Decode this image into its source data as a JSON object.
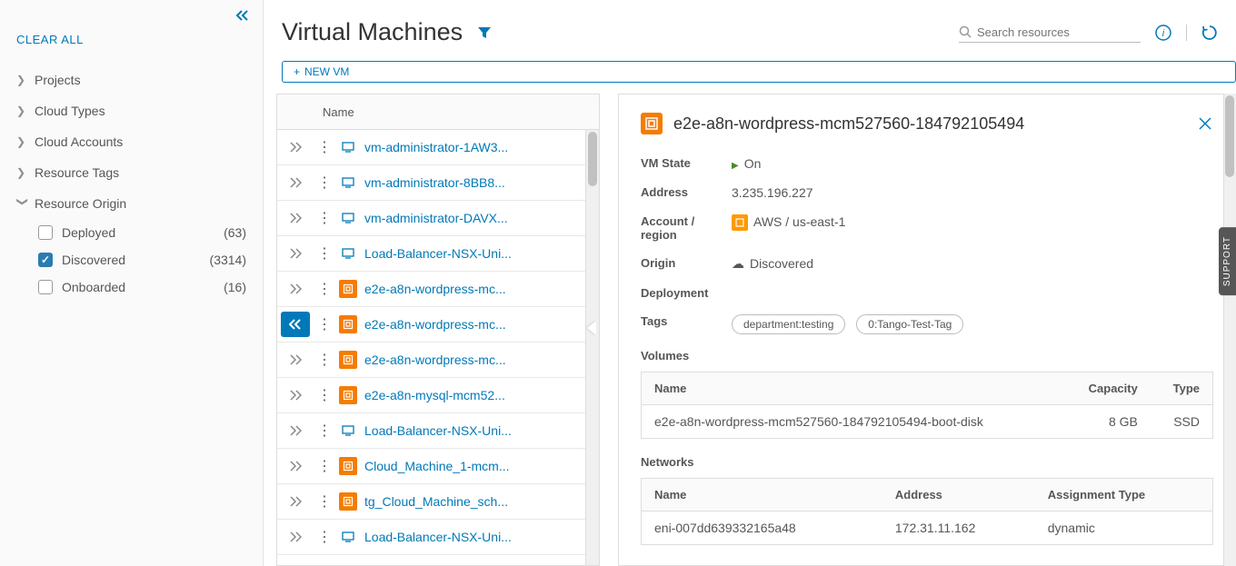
{
  "sidebar": {
    "clear_all": "CLEAR ALL",
    "filters": [
      {
        "label": "Projects",
        "expanded": false
      },
      {
        "label": "Cloud Types",
        "expanded": false
      },
      {
        "label": "Cloud Accounts",
        "expanded": false
      },
      {
        "label": "Resource Tags",
        "expanded": false
      },
      {
        "label": "Resource Origin",
        "expanded": true
      }
    ],
    "origin_options": [
      {
        "label": "Deployed",
        "count": "(63)",
        "checked": false
      },
      {
        "label": "Discovered",
        "count": "(3314)",
        "checked": true
      },
      {
        "label": "Onboarded",
        "count": "(16)",
        "checked": false
      }
    ]
  },
  "header": {
    "title": "Virtual Machines",
    "search_placeholder": "Search resources",
    "new_vm_label": "NEW VM"
  },
  "vm_list": {
    "name_header": "Name",
    "rows": [
      {
        "name": "vm-administrator-1AW3...",
        "icon": "blue",
        "selected": false
      },
      {
        "name": "vm-administrator-8BB8...",
        "icon": "blue",
        "selected": false
      },
      {
        "name": "vm-administrator-DAVX...",
        "icon": "blue",
        "selected": false
      },
      {
        "name": "Load-Balancer-NSX-Uni...",
        "icon": "blue",
        "selected": false
      },
      {
        "name": "e2e-a8n-wordpress-mc...",
        "icon": "orange",
        "selected": false
      },
      {
        "name": "e2e-a8n-wordpress-mc...",
        "icon": "orange",
        "selected": true
      },
      {
        "name": "e2e-a8n-wordpress-mc...",
        "icon": "orange",
        "selected": false
      },
      {
        "name": "e2e-a8n-mysql-mcm52...",
        "icon": "orange",
        "selected": false
      },
      {
        "name": "Load-Balancer-NSX-Uni...",
        "icon": "blue",
        "selected": false
      },
      {
        "name": "Cloud_Machine_1-mcm...",
        "icon": "orange",
        "selected": false
      },
      {
        "name": "tg_Cloud_Machine_sch...",
        "icon": "orange",
        "selected": false
      },
      {
        "name": "Load-Balancer-NSX-Uni...",
        "icon": "blue",
        "selected": false
      }
    ]
  },
  "details": {
    "title": "e2e-a8n-wordpress-mcm527560-184792105494",
    "labels": {
      "vm_state": "VM State",
      "address": "Address",
      "account": "Account / region",
      "origin": "Origin",
      "deployment": "Deployment",
      "tags": "Tags",
      "volumes": "Volumes",
      "networks": "Networks"
    },
    "state": "On",
    "address": "3.235.196.227",
    "account": "AWS / us-east-1",
    "origin": "Discovered",
    "tags": [
      "department:testing",
      "0:Tango-Test-Tag"
    ],
    "volumes": {
      "headers": {
        "name": "Name",
        "capacity": "Capacity",
        "type": "Type"
      },
      "row": {
        "name": "e2e-a8n-wordpress-mcm527560-184792105494-boot-disk",
        "capacity": "8 GB",
        "type": "SSD"
      }
    },
    "networks": {
      "headers": {
        "name": "Name",
        "address": "Address",
        "assignment": "Assignment Type"
      },
      "row": {
        "name": "eni-007dd639332165a48",
        "address": "172.31.11.162",
        "assignment": "dynamic"
      }
    }
  },
  "support_label": "SUPPORT"
}
